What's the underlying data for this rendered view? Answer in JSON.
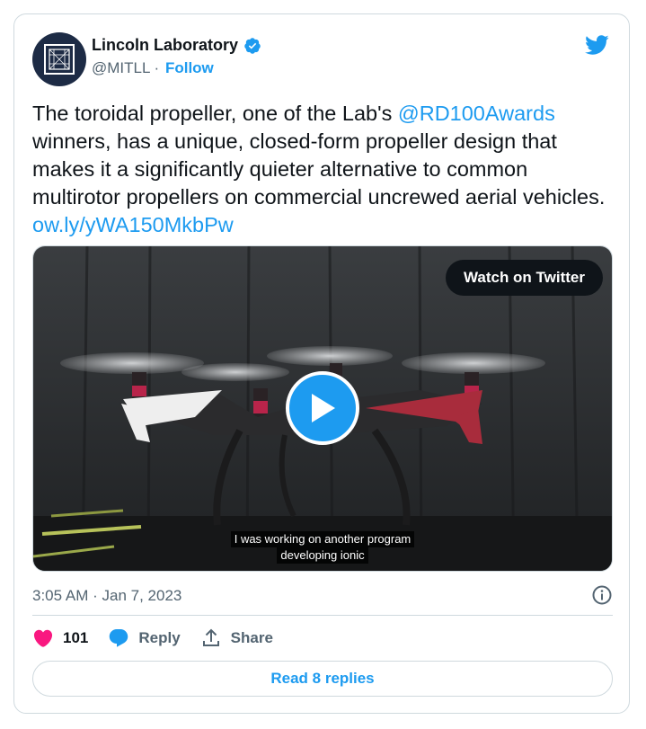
{
  "author": {
    "name": "Lincoln Laboratory",
    "handle": "@MITLL",
    "separator": "·",
    "follow_label": "Follow"
  },
  "tweet": {
    "text_before_mention": "The toroidal propeller, one of the Lab's ",
    "mention": "@RD100Awards",
    "text_after_mention": " winners, has a unique, closed-form propeller design that makes it a significantly quieter alternative to common multirotor propellers on commercial uncrewed aerial vehicles. ",
    "link": "ow.ly/yWA150MkbPw"
  },
  "media": {
    "watch_label": "Watch on Twitter",
    "caption_line1": "I was working on another program",
    "caption_line2": "developing ionic"
  },
  "meta": {
    "time": "3:05 AM",
    "separator": "·",
    "date": "Jan 7, 2023"
  },
  "actions": {
    "like_count": "101",
    "reply_label": "Reply",
    "share_label": "Share"
  },
  "footer": {
    "read_replies_label": "Read 8 replies"
  },
  "colors": {
    "accent": "#1d9bf0",
    "like": "#f91880",
    "text": "#0f1419",
    "muted": "#536471",
    "border": "#cfd9de"
  },
  "icons": [
    "verified-badge-icon",
    "twitter-bird-icon",
    "play-icon",
    "info-icon",
    "heart-icon",
    "reply-bubble-icon",
    "share-icon"
  ]
}
